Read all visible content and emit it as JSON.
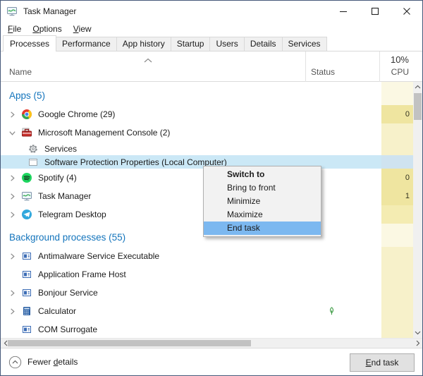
{
  "titlebar": {
    "title": "Task Manager"
  },
  "window_controls": {
    "minimize": "minimize",
    "maximize": "maximize",
    "close": "close"
  },
  "menubar": {
    "items": [
      {
        "label": "File",
        "underline": 0
      },
      {
        "label": "Options",
        "underline": 0
      },
      {
        "label": "View",
        "underline": 0
      }
    ]
  },
  "tabs": {
    "items": [
      {
        "label": "Processes",
        "active": true
      },
      {
        "label": "Performance",
        "active": false
      },
      {
        "label": "App history",
        "active": false
      },
      {
        "label": "Startup",
        "active": false
      },
      {
        "label": "Users",
        "active": false
      },
      {
        "label": "Details",
        "active": false
      },
      {
        "label": "Services",
        "active": false
      }
    ]
  },
  "table": {
    "columns": {
      "name": "Name",
      "status": "Status",
      "cpu_percent": "10%",
      "cpu": "CPU"
    }
  },
  "rows": [
    {
      "type": "group",
      "name": "Apps (5)",
      "shade": "xlight"
    },
    {
      "type": "process",
      "name": "Google Chrome (29)",
      "icon": "chrome",
      "chevron": "right",
      "cpu": "0",
      "shade": "dark"
    },
    {
      "type": "process",
      "name": "Microsoft Management Console (2)",
      "icon": "mmc",
      "chevron": "down",
      "shade": "light"
    },
    {
      "type": "child",
      "name": "Services",
      "icon": "gear",
      "shade": "light"
    },
    {
      "type": "child",
      "name": "Software Protection Properties (Local Computer)",
      "icon": "window",
      "selected": true
    },
    {
      "type": "process",
      "name": "Spotify (4)",
      "icon": "spotify",
      "chevron": "right",
      "cpu": "0",
      "shade": "dark"
    },
    {
      "type": "process",
      "name": "Task Manager",
      "icon": "taskmgr",
      "chevron": "right",
      "cpu": "1",
      "shade": "dark"
    },
    {
      "type": "process",
      "name": "Telegram Desktop",
      "icon": "telegram",
      "chevron": "right",
      "shade": "medium"
    },
    {
      "type": "group",
      "name": "Background processes (55)",
      "shade": "xlight"
    },
    {
      "type": "process",
      "name": "Antimalware Service Executable",
      "icon": "generic",
      "chevron": "right",
      "shade": "light"
    },
    {
      "type": "process",
      "name": "Application Frame Host",
      "icon": "generic",
      "shade": "light"
    },
    {
      "type": "process",
      "name": "Bonjour Service",
      "icon": "generic",
      "chevron": "right",
      "shade": "light"
    },
    {
      "type": "process",
      "name": "Calculator",
      "icon": "calc",
      "chevron": "right",
      "status_icon": "leaf",
      "shade": "light"
    },
    {
      "type": "process",
      "name": "COM Surrogate",
      "icon": "generic",
      "shade": "light"
    }
  ],
  "context_menu": {
    "items": [
      {
        "label": "Switch to",
        "bold": true
      },
      {
        "label": "Bring to front"
      },
      {
        "label": "Minimize"
      },
      {
        "label": "Maximize"
      },
      {
        "label": "End task",
        "highlighted": true
      }
    ]
  },
  "footer": {
    "details_toggle": {
      "label": "Fewer details",
      "underline": 6
    },
    "end_task_button": {
      "label": "End task",
      "underline": 0
    }
  },
  "colors": {
    "selection": "#cbe8f6",
    "menu_highlight": "#7cb8f0",
    "group_text": "#1374bc",
    "cpu_shades": {
      "xlight": "#fbf8e3",
      "light": "#f7f1ca",
      "medium": "#f4ecb2",
      "dark": "#efe5a0",
      "selected": "#cfe3f0"
    }
  }
}
